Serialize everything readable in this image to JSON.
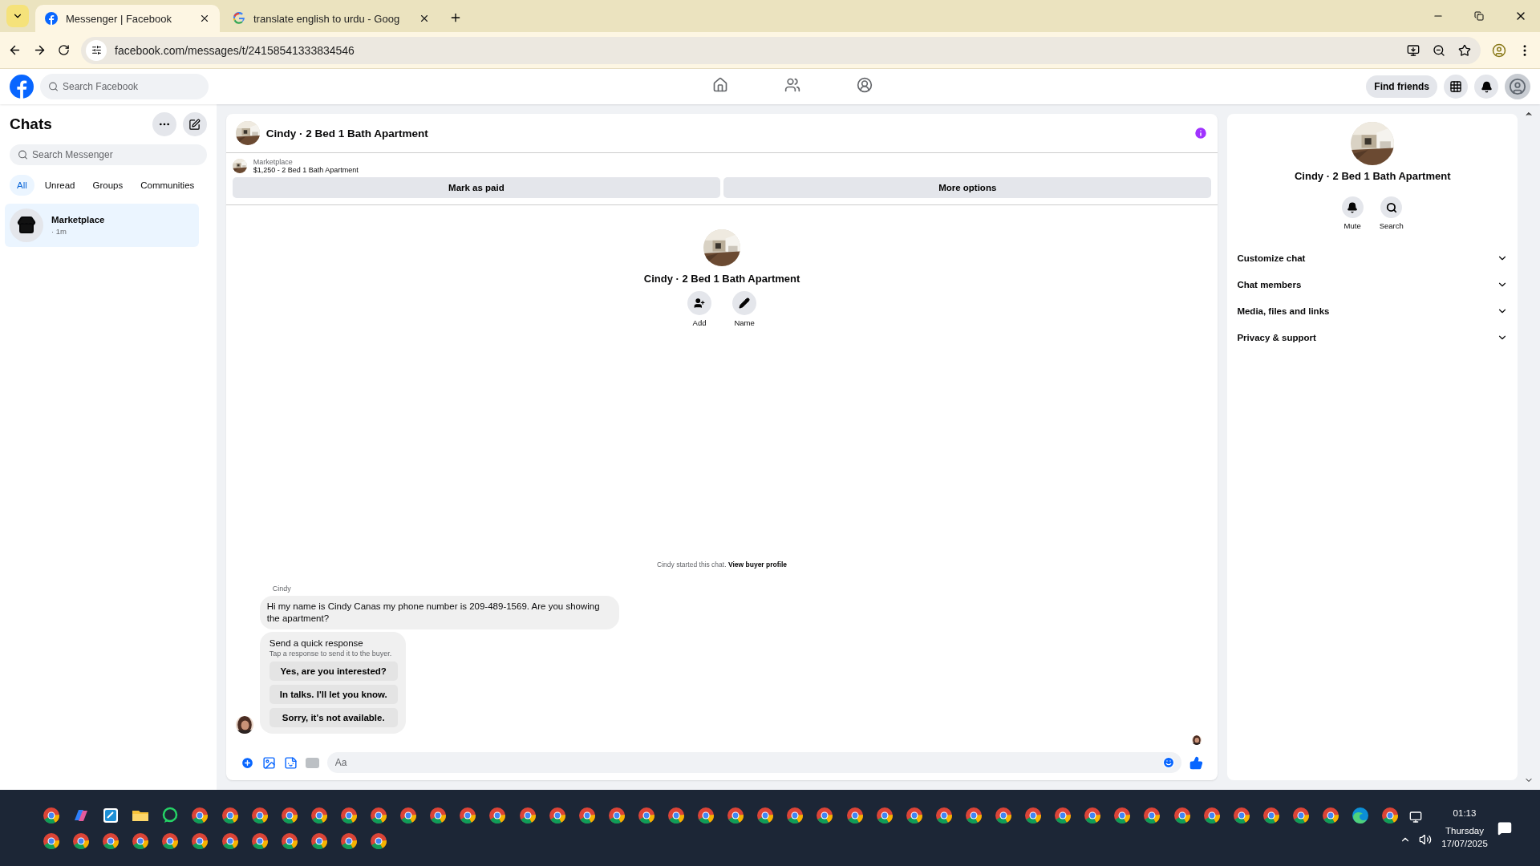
{
  "browser": {
    "tabs": [
      {
        "title": "Messenger | Facebook",
        "kind": "facebook",
        "selected": true
      },
      {
        "title": "translate english to urdu - Goog",
        "kind": "google",
        "selected": false
      }
    ],
    "url": "facebook.com/messages/t/24158541333834546"
  },
  "header": {
    "search_placeholder": "Search Facebook",
    "nav": [
      {
        "kind": "home"
      },
      {
        "kind": "friends"
      },
      {
        "kind": "groups"
      }
    ],
    "find_friends": "Find friends"
  },
  "sidebar": {
    "title": "Chats",
    "search_placeholder": "Search Messenger",
    "filters": [
      {
        "label": "All",
        "selected": true
      },
      {
        "label": "Unread",
        "selected": false
      },
      {
        "label": "Groups",
        "selected": false
      },
      {
        "label": "Communities",
        "selected": false
      }
    ],
    "conversations": [
      {
        "name": "Marketplace",
        "time": "· 1m",
        "selected": true
      }
    ]
  },
  "chat": {
    "title": "Cindy · 2 Bed 1 Bath Apartment",
    "listing": {
      "source": "Marketplace",
      "text": "$1,250 - 2 Bed 1 Bath Apartment"
    },
    "actions": [
      "Mark as paid",
      "More options"
    ],
    "profile": {
      "name": "Cindy · 2 Bed 1 Bath Apartment",
      "actions": [
        {
          "kind": "add",
          "label": "Add"
        },
        {
          "kind": "edit",
          "label": "Name"
        }
      ]
    },
    "notice": {
      "text": "Cindy started this chat.",
      "link": "View buyer profile"
    },
    "sender": "Cindy",
    "message": "Hi my name is Cindy Canas my phone number is 209-489-1569. Are you showing the apartment?",
    "quick_response": {
      "title": "Send a quick response",
      "subtitle": "Tap a response to send it to the buyer.",
      "options": [
        "Yes, are you interested?",
        "In talks. I'll let you know.",
        "Sorry, it's not available."
      ]
    },
    "composer_placeholder": "Aa"
  },
  "details": {
    "name": "Cindy · 2 Bed 1 Bath Apartment",
    "actions": [
      {
        "kind": "mute",
        "label": "Mute"
      },
      {
        "kind": "search",
        "label": "Search"
      }
    ],
    "sections": [
      "Customize chat",
      "Chat members",
      "Media, files and links",
      "Privacy & support"
    ]
  },
  "taskbar": {
    "row_1": [
      {
        "kind": "browser"
      },
      {
        "kind": "copilot"
      },
      {
        "kind": "app"
      },
      {
        "kind": "folder"
      },
      {
        "kind": "whatsapp"
      },
      {
        "kind": "browser"
      },
      {
        "kind": "browser"
      },
      {
        "kind": "browser"
      },
      {
        "kind": "browser"
      },
      {
        "kind": "browser"
      },
      {
        "kind": "browser"
      },
      {
        "kind": "browser"
      },
      {
        "kind": "browser"
      },
      {
        "kind": "browser"
      },
      {
        "kind": "browser"
      },
      {
        "kind": "browser"
      },
      {
        "kind": "browser"
      },
      {
        "kind": "browser"
      },
      {
        "kind": "browser"
      },
      {
        "kind": "browser"
      },
      {
        "kind": "browser"
      },
      {
        "kind": "browser"
      },
      {
        "kind": "browser"
      },
      {
        "kind": "browser"
      },
      {
        "kind": "browser"
      },
      {
        "kind": "browser"
      },
      {
        "kind": "browser"
      },
      {
        "kind": "browser"
      },
      {
        "kind": "browser"
      },
      {
        "kind": "browser"
      },
      {
        "kind": "browser"
      },
      {
        "kind": "browser"
      },
      {
        "kind": "browser"
      },
      {
        "kind": "browser"
      },
      {
        "kind": "browser"
      },
      {
        "kind": "browser"
      },
      {
        "kind": "browser"
      },
      {
        "kind": "browser"
      },
      {
        "kind": "browser"
      },
      {
        "kind": "browser"
      },
      {
        "kind": "browser"
      },
      {
        "kind": "browser"
      },
      {
        "kind": "browser"
      },
      {
        "kind": "browser"
      },
      {
        "kind": "edge"
      },
      {
        "kind": "browser"
      }
    ],
    "row_2": [
      {
        "kind": "browser"
      },
      {
        "kind": "browser"
      },
      {
        "kind": "browser"
      },
      {
        "kind": "browser"
      },
      {
        "kind": "browser"
      },
      {
        "kind": "browser"
      },
      {
        "kind": "browser"
      },
      {
        "kind": "browser"
      },
      {
        "kind": "browser"
      },
      {
        "kind": "browser"
      },
      {
        "kind": "browser"
      },
      {
        "kind": "browser"
      }
    ],
    "clock": {
      "time": "01:13",
      "day": "Thursday",
      "date": "17/07/2025"
    }
  }
}
